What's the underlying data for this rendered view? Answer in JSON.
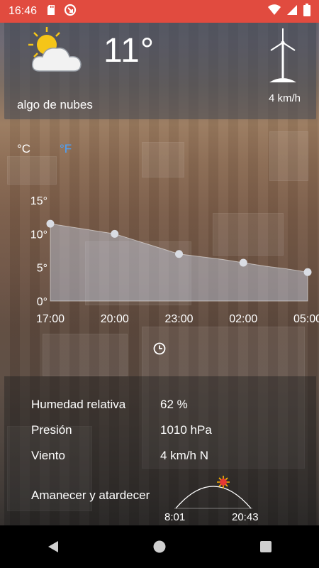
{
  "status_bar": {
    "time": "16:46",
    "background": "#e14b3f",
    "icons": [
      "sd-card-icon",
      "sync-icon",
      "wifi-icon",
      "signal-icon",
      "battery-icon"
    ]
  },
  "current": {
    "temperature": "11°",
    "condition": "algo de nubes",
    "wind": "4 km/h",
    "icon": "partly-cloudy-icon"
  },
  "units": {
    "celsius": "°C",
    "fahrenheit": "°F",
    "active": "celsius",
    "active_color": "#ffffff",
    "inactive_color": "#4aa3ff"
  },
  "chart_data": {
    "type": "area",
    "x": [
      "17:00",
      "18:00",
      "19:00",
      "20:00",
      "21:00",
      "22:00",
      "23:00",
      "00:00",
      "01:00",
      "02:00",
      "03:00",
      "04:00",
      "05:00"
    ],
    "x_ticks": [
      "17:00",
      "20:00",
      "23:00",
      "02:00",
      "05:00"
    ],
    "values": [
      11.5,
      11.0,
      10.5,
      10.0,
      9.0,
      8.0,
      7.0,
      6.6,
      6.2,
      5.7,
      5.2,
      4.8,
      4.3
    ],
    "marked_points": [
      {
        "x": "17:00",
        "y": 11.5
      },
      {
        "x": "20:00",
        "y": 10.0
      },
      {
        "x": "23:00",
        "y": 7.0
      },
      {
        "x": "02:00",
        "y": 5.7
      },
      {
        "x": "05:00",
        "y": 4.3
      }
    ],
    "y_ticks": [
      "0°",
      "5°",
      "10°",
      "15°"
    ],
    "ylim": [
      0,
      15
    ],
    "title": "",
    "xlabel": "",
    "ylabel": "",
    "fill_color": "rgba(200,210,230,0.45)",
    "grid": false
  },
  "details": {
    "humidity_label": "Humedad relativa",
    "humidity_value": "62 %",
    "pressure_label": "Presión",
    "pressure_value": "1010 hPa",
    "wind_label": "Viento",
    "wind_value": "4 km/h N",
    "sun_title": "Amanecer y atardecer",
    "sunrise": "8:01",
    "sunset": "20:43"
  },
  "navbar": {
    "buttons": [
      "back-icon",
      "home-icon",
      "recents-icon"
    ]
  }
}
